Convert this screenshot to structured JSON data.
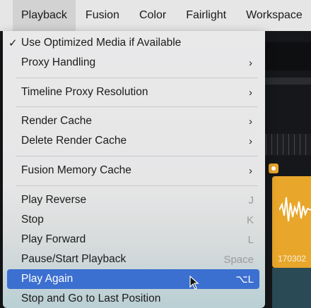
{
  "menubar": {
    "items": [
      "Playback",
      "Fusion",
      "Color",
      "Fairlight",
      "Workspace"
    ]
  },
  "menu": {
    "use_optimized": {
      "label": "Use Optimized Media if Available",
      "checked": true,
      "check": "✓"
    },
    "proxy_handling": {
      "label": "Proxy Handling",
      "submenu": "›"
    },
    "timeline_proxy": {
      "label": "Timeline Proxy Resolution",
      "submenu": "›"
    },
    "render_cache": {
      "label": "Render Cache",
      "submenu": "›"
    },
    "delete_render_cache": {
      "label": "Delete Render Cache",
      "submenu": "›"
    },
    "fusion_memory": {
      "label": "Fusion Memory Cache",
      "submenu": "›"
    },
    "play_reverse": {
      "label": "Play Reverse",
      "shortcut": "J"
    },
    "stop": {
      "label": "Stop",
      "shortcut": "K"
    },
    "play_forward": {
      "label": "Play Forward",
      "shortcut": "L"
    },
    "pause_start": {
      "label": "Pause/Start Playback",
      "shortcut": "Space"
    },
    "play_again": {
      "label": "Play Again",
      "shortcut": "⌥L",
      "highlighted": true
    },
    "stop_go_last": {
      "label": "Stop and Go to Last Position"
    }
  },
  "timeline": {
    "clip_label": "170302",
    "clip_color": "#e8a62a"
  },
  "colors": {
    "highlight": "#3b6fd0",
    "menubar_bg": "#e6e6e6"
  }
}
